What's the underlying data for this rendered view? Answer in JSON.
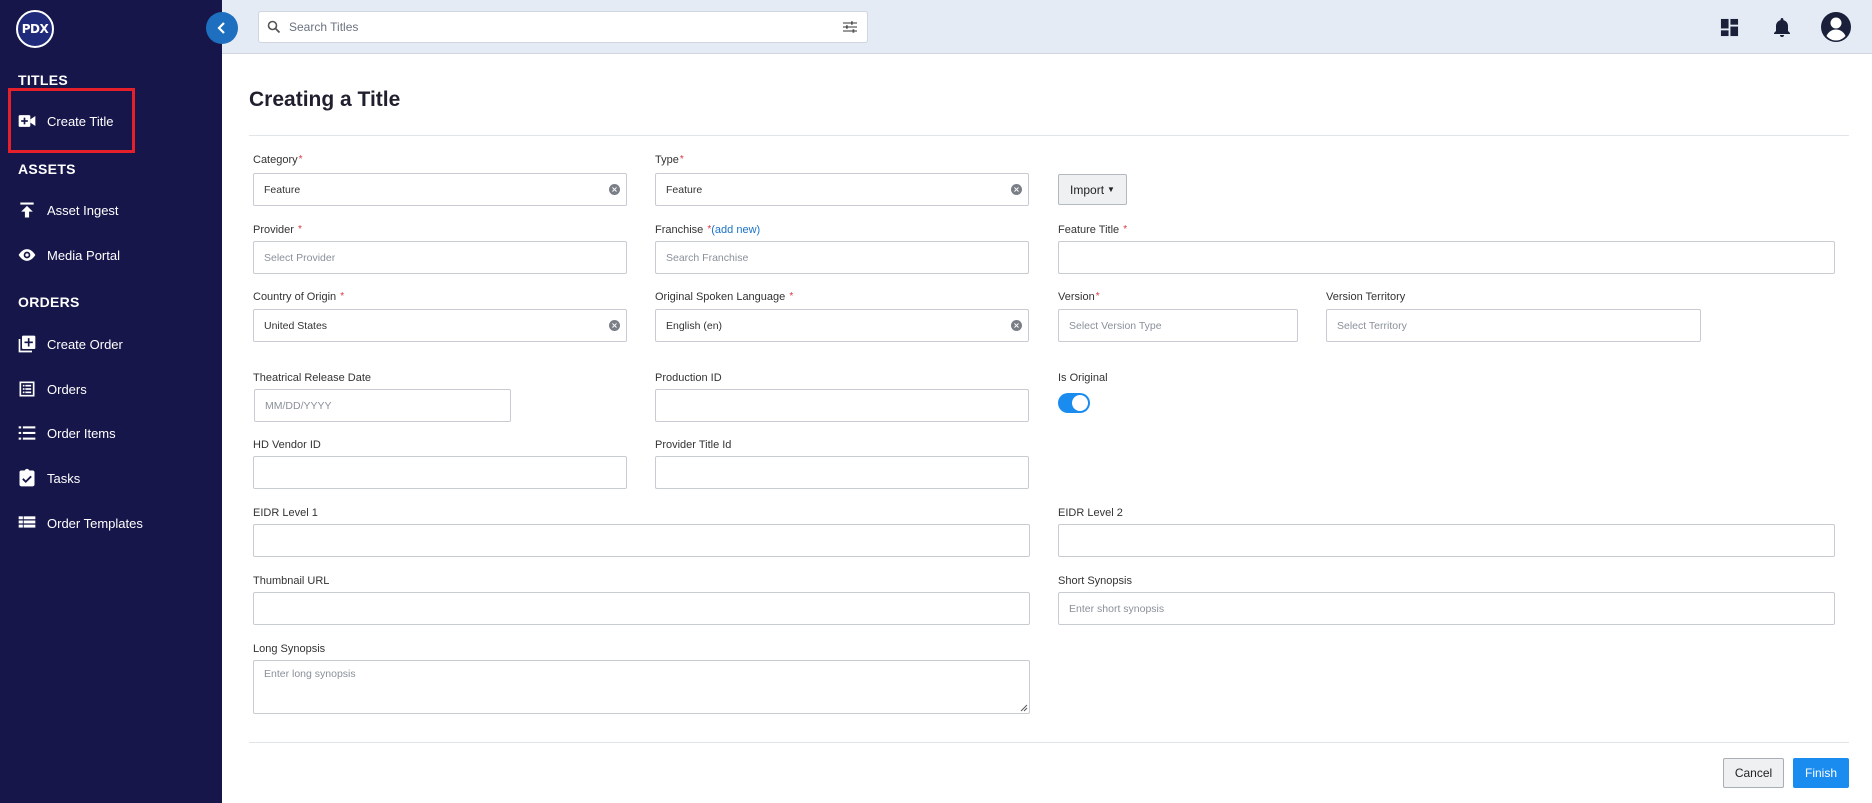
{
  "sidebar": {
    "logo_text": "PDX",
    "sections": {
      "titles": "TITLES",
      "assets": "ASSETS",
      "orders": "ORDERS"
    },
    "items": {
      "create_title": "Create Title",
      "asset_ingest": "Asset Ingest",
      "media_portal": "Media Portal",
      "create_order": "Create Order",
      "orders": "Orders",
      "order_items": "Order Items",
      "tasks": "Tasks",
      "order_templates": "Order Templates"
    }
  },
  "topbar": {
    "search_placeholder": "Search Titles"
  },
  "main": {
    "title": "Creating a Title",
    "required_marker": "*",
    "fields": {
      "category": {
        "label": "Category",
        "value": "Feature"
      },
      "type": {
        "label": "Type",
        "value": "Feature"
      },
      "import_label": "Import",
      "provider": {
        "label": "Provider",
        "placeholder": "Select Provider"
      },
      "franchise": {
        "label": "Franchise",
        "add_new": "(add new)",
        "placeholder": "Search Franchise"
      },
      "feature_title": {
        "label": "Feature Title",
        "value": ""
      },
      "country_of_origin": {
        "label": "Country of Origin",
        "value": "United States"
      },
      "original_spoken_language": {
        "label": "Original Spoken Language",
        "value": "English (en)"
      },
      "version": {
        "label": "Version",
        "placeholder": "Select Version Type"
      },
      "version_territory": {
        "label": "Version Territory",
        "placeholder": "Select Territory"
      },
      "theatrical_release_date": {
        "label": "Theatrical Release Date",
        "placeholder": "MM/DD/YYYY"
      },
      "production_id": {
        "label": "Production ID",
        "value": ""
      },
      "is_original": {
        "label": "Is Original",
        "checked": true
      },
      "hd_vendor_id": {
        "label": "HD Vendor ID",
        "value": ""
      },
      "provider_title_id": {
        "label": "Provider Title Id",
        "value": ""
      },
      "eidr_level_1": {
        "label": "EIDR Level 1",
        "value": ""
      },
      "eidr_level_2": {
        "label": "EIDR Level 2",
        "value": ""
      },
      "thumbnail_url": {
        "label": "Thumbnail URL",
        "value": ""
      },
      "short_synopsis": {
        "label": "Short Synopsis",
        "placeholder": "Enter short synopsis"
      },
      "long_synopsis": {
        "label": "Long Synopsis",
        "placeholder": "Enter long synopsis"
      }
    },
    "buttons": {
      "cancel": "Cancel",
      "finish": "Finish"
    }
  },
  "colors": {
    "sidebar_bg": "#16164a",
    "accent": "#1a8cf0",
    "highlight": "#e5202b",
    "required": "#d9363e"
  }
}
